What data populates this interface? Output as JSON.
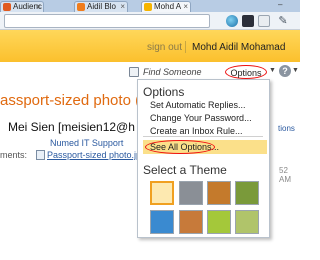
{
  "browser": {
    "tabs": [
      {
        "label": "Audienc",
        "favicon_color": "#e05a20"
      },
      {
        "label": "Aidil Blo",
        "favicon_color": "#f07c1c"
      },
      {
        "label": "Mohd A",
        "favicon_color": "#f5b400"
      }
    ],
    "minimize_glyph": "–"
  },
  "header": {
    "sign_out_label": "sign out",
    "user_name": "Mohd Aidil Mohamad"
  },
  "toolbar": {
    "find_someone_label": "Find Someone",
    "options_label": "Options",
    "help_glyph": "?"
  },
  "options_menu": {
    "title": "Options",
    "items": [
      {
        "label": "Set Automatic Replies..."
      },
      {
        "label": "Change Your Password..."
      },
      {
        "label": "Create an Inbox Rule..."
      },
      {
        "label": "See All Options..."
      }
    ],
    "theme_section_title": "Select a Theme",
    "themes": [
      {
        "name": "default",
        "color": "#fde9b0"
      },
      {
        "name": "silver",
        "color": "#8a8f96"
      },
      {
        "name": "cartoon",
        "color": "#c47a2c"
      },
      {
        "name": "nature",
        "color": "#7a9a3a"
      },
      {
        "name": "ocean",
        "color": "#3a8ad0"
      },
      {
        "name": "stripes",
        "color": "#c77a3a"
      },
      {
        "name": "grass",
        "color": "#a4c83a"
      },
      {
        "name": "floral",
        "color": "#b0c46a"
      }
    ]
  },
  "message": {
    "subject": "assport-sized photo (L",
    "sender": "Mei Sien [meisien12@h",
    "recipient_label": "Numed IT Support",
    "attachments_label": "ments:",
    "attachment_link": "Passport-sized photo.jpg (313",
    "right_action": "tions",
    "right_time": "52 AM"
  }
}
